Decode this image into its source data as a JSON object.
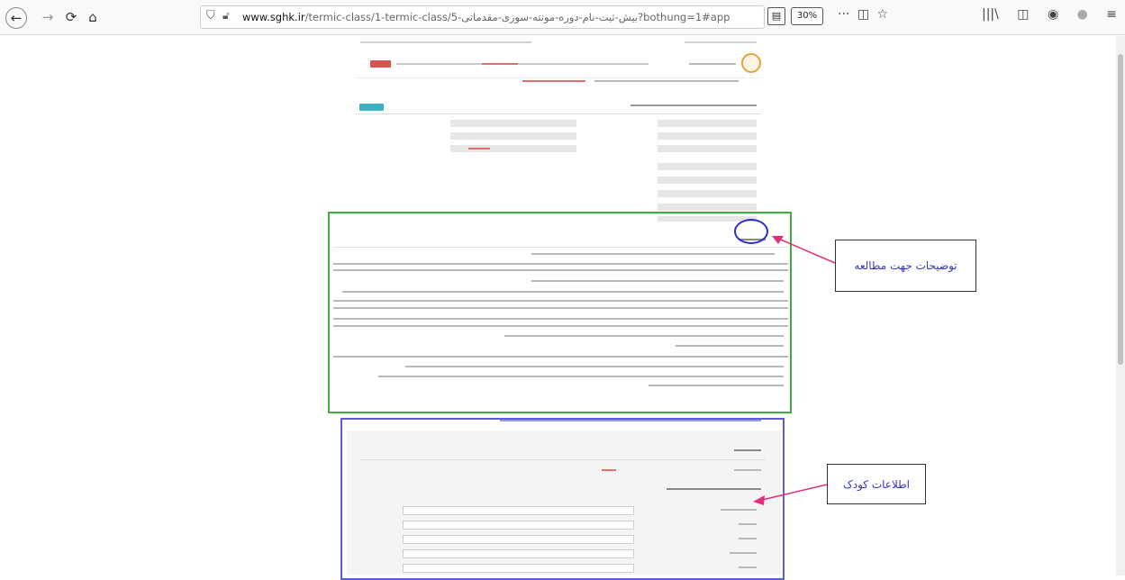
{
  "browser": {
    "url_domain": "www.sghk.ir",
    "url_path": "/termic-class/1-termic-class/5-بیش-ثبت-نام-دوره-مونته-سوری-مقدماتی?bothung=1#app",
    "zoom": "30%",
    "back_icon": "←",
    "forward_icon": "→",
    "reload_icon": "⟳",
    "home_icon": "⌂",
    "more_icon": "···",
    "pocket_icon": "◫",
    "star_icon": "☆",
    "library_icon": "|||\\",
    "sidebar_icon": "◫",
    "account_icon": "◉",
    "extension_icon": "●",
    "menu_icon": "≡"
  },
  "annotations": {
    "study_notes": "توضیحات جهت مطالعه",
    "child_info": "اطلاعات کودک"
  },
  "page": {
    "required_label": "الزامی"
  }
}
